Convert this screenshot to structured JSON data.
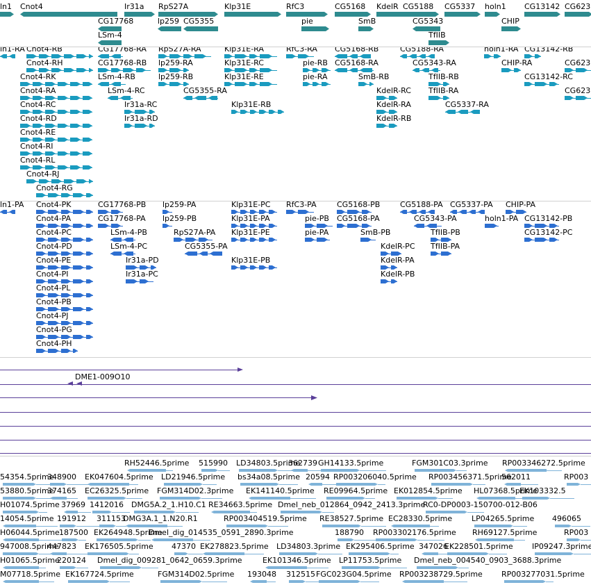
{
  "colors": {
    "gene": "#2e8b8f",
    "transcript": "#1a9bbf",
    "protein": "#2d6fd1",
    "alignment": "#5a3f99",
    "est": "#7fb3d9"
  },
  "tracks": {
    "genes": [
      {
        "label": "ln1",
        "dir": "right"
      },
      {
        "label": "Cnot4",
        "dir": "left"
      },
      {
        "label": "Ir31a",
        "dir": "right"
      },
      {
        "label": "RpS27A",
        "dir": "right"
      },
      {
        "label": "Klp31E",
        "dir": "right"
      },
      {
        "label": "RfC3",
        "dir": "right"
      },
      {
        "label": "CG5168",
        "dir": "right"
      },
      {
        "label": "KdelR",
        "dir": "right"
      },
      {
        "label": "CG5188",
        "dir": "right"
      },
      {
        "label": "CG5337",
        "dir": "right"
      },
      {
        "label": "holn1",
        "dir": "right"
      },
      {
        "label": "CG13142",
        "dir": "right"
      },
      {
        "label": "CG623",
        "dir": "right"
      },
      {
        "label": "CG17768",
        "dir": "left"
      },
      {
        "label": "lp259",
        "dir": "left"
      },
      {
        "label": "CG5355",
        "dir": "left"
      },
      {
        "label": "pie",
        "dir": "right"
      },
      {
        "label": "SmB",
        "dir": "right"
      },
      {
        "label": "CG5343",
        "dir": "left"
      },
      {
        "label": "CHIP",
        "dir": "right"
      },
      {
        "label": "LSm-4",
        "dir": "left"
      },
      {
        "label": "TfIIB",
        "dir": "right"
      }
    ],
    "transcripts": [
      "ln1-RA",
      "Cnot4-RB",
      "CG17768-RA",
      "RpS27A-RA",
      "Klp31E-RA",
      "RfC3-RA",
      "CG5168-RB",
      "CG5188-RA",
      "holn1-RA",
      "CG13142-RB",
      "Cnot4-RH",
      "CG17768-RB",
      "lp259-RA",
      "Klp31E-RC",
      "pie-RB",
      "CG5168-RA",
      "CG5343-RA",
      "CHIP-RA",
      "CG623",
      "Cnot4-RK",
      "LSm-4-RB",
      "lp259-RB",
      "Klp31E-RE",
      "pie-RA",
      "SmB-RB",
      "TfIIB-RB",
      "CG13142-RC",
      "Cnot4-RA",
      "LSm-4-RC",
      "CG5355-RA",
      "KdelR-RC",
      "TfIIB-RA",
      "CG623",
      "Cnot4-RC",
      "Ir31a-RC",
      "Klp31E-RB",
      "KdelR-RA",
      "CG5337-RA",
      "Cnot4-RD",
      "Ir31a-RD",
      "KdelR-RB",
      "Cnot4-RE",
      "Cnot4-RI",
      "Cnot4-RL",
      "Cnot4-RJ",
      "Cnot4-RG"
    ],
    "proteins": [
      "ln1-PA",
      "Cnot4-PK",
      "CG17768-PB",
      "lp259-PA",
      "Klp31E-PC",
      "RfC3-PA",
      "CG5168-PB",
      "CG5188-PA",
      "CG5337-PA",
      "CHIP-PA",
      "Cnot4-PA",
      "CG17768-PA",
      "lp259-PB",
      "Klp31E-PA",
      "pie-PB",
      "CG5168-PA",
      "CG5343-PA",
      "holn1-PA",
      "CG13142-PB",
      "Cnot4-PC",
      "LSm-4-PB",
      "RpS27A-PA",
      "Klp31E-PE",
      "pie-PA",
      "SmB-PB",
      "TfIIB-PB",
      "CG13142-PC",
      "Cnot4-PD",
      "LSm-4-PC",
      "CG5355-PA",
      "KdelR-PC",
      "TfIIB-PA",
      "Cnot4-PE",
      "Ir31a-PD",
      "Klp31E-PB",
      "KdelR-PA",
      "Cnot4-PI",
      "Ir31a-PC",
      "KdelR-PB",
      "Cnot4-PL",
      "Cnot4-PB",
      "Cnot4-PJ",
      "Cnot4-PG",
      "Cnot4-PH"
    ],
    "alignment_label": "DME1-009O10",
    "ests": [
      "RH52446.5prime",
      "515990",
      "LD34803.5prime",
      "362739",
      "GH14133.5prime",
      "FGM301C03.3prime",
      "RP003346272.5prime",
      "54354.5prime",
      "348900",
      "EK047604.5prime",
      "LD21946.5prime",
      "bs34a08.5prime",
      "20594",
      "RP003206040.5prime",
      "RP003456371.5prime",
      "562011",
      "RP003",
      "53880.5prime",
      "374165",
      "EC26325.5prime",
      "FGM314D02.3prime",
      "EK141140.5prime",
      "RE09964.5prime",
      "EK012854.5prime",
      "HL07368.5prime",
      "EK103332.5",
      "H01074.5prime",
      "37969",
      "1412016",
      "DMG5A.2_1.H10.C1",
      "RE34663.5prime",
      "Dmel_neb_012864_0942_2413.3prime",
      "RC0-DP0003-150700-012-B06",
      "14054.5prime",
      "191912",
      "311153",
      "DMG3A.1_1.N20.R1",
      "RP003404519.5prime",
      "RE38527.5prime",
      "EC28330.5prime",
      "LP04265.5prime",
      "496065",
      "H06044.5prime",
      "187500",
      "EK264948.5prime",
      "Dmel_dig_014535_0591_2890.3prime",
      "188790",
      "RP003302176.5prime",
      "RH69127.5prime",
      "RP003",
      "947008.5prime",
      "447823",
      "EK176505.5prime",
      "47370",
      "EK278823.5prime",
      "LD34803.3prime",
      "EK295406.5prime",
      "347026",
      "EK228501.5prime",
      "IP09247.3prime",
      "H01065.5prime",
      "220124",
      "Dmel_dig_009281_0642_0659.3prime",
      "EK101346.5prime",
      "LP11753.5prime",
      "Dmel_neb_004540_0903_3688.3prime",
      "M07718.5prime",
      "EK167724.5prime",
      "FGM314D02.5prime",
      "193048",
      "312515",
      "FGC023G04.5prime",
      "RP003238729.5prime",
      "RP003277031.5prime"
    ]
  }
}
